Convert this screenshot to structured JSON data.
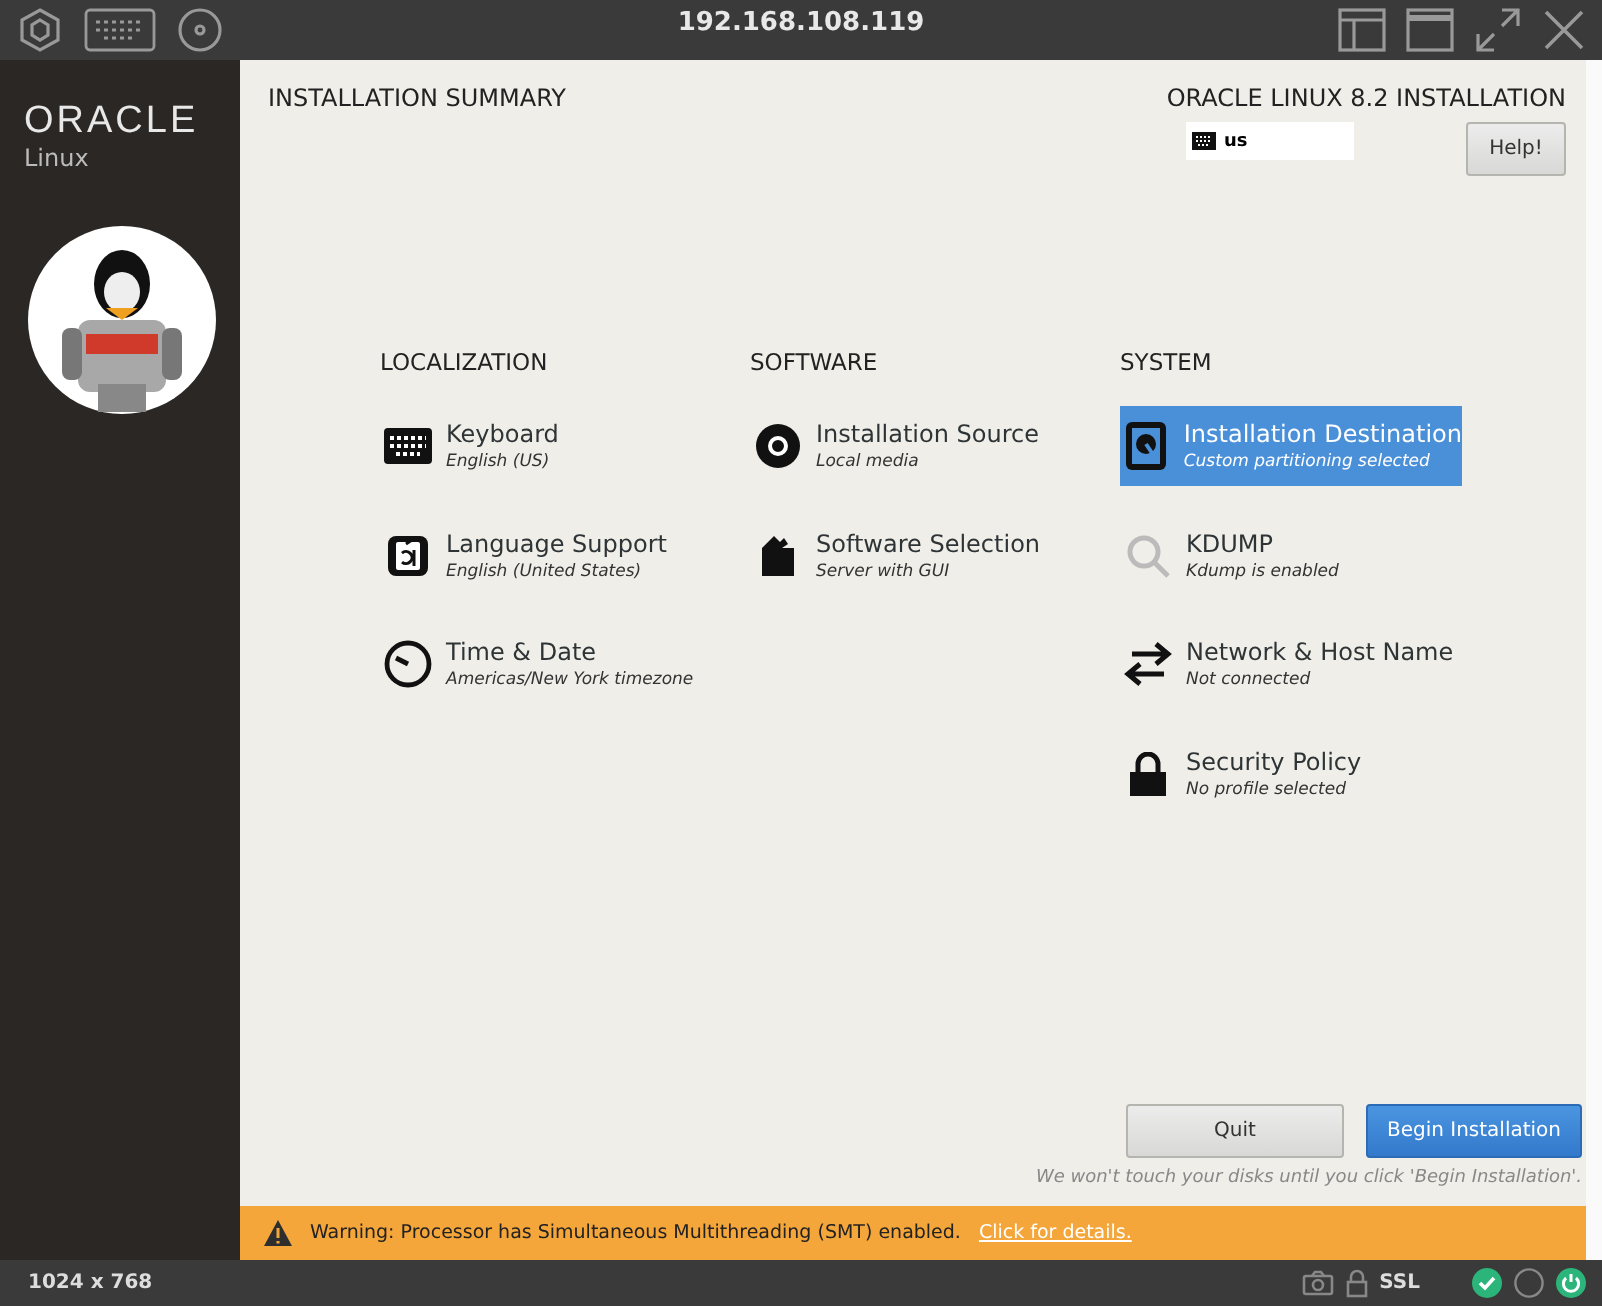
{
  "window": {
    "title": "192.168.108.119"
  },
  "sidebar": {
    "logo_brand": "ORACLE",
    "logo_product": "Linux"
  },
  "header": {
    "title": "INSTALLATION SUMMARY",
    "product": "ORACLE LINUX 8.2 INSTALLATION",
    "keyboard_layout": "us",
    "help_button": "Help!"
  },
  "sections": [
    {
      "heading": "LOCALIZATION",
      "items": [
        {
          "kind": "keyboard",
          "title": "Keyboard",
          "status": "English (US)",
          "selected": false
        },
        {
          "kind": "language",
          "title": "Language Support",
          "status": "English (United States)",
          "selected": false
        },
        {
          "kind": "clock",
          "title": "Time & Date",
          "status": "Americas/New York timezone",
          "selected": false
        }
      ]
    },
    {
      "heading": "SOFTWARE",
      "items": [
        {
          "kind": "disc",
          "title": "Installation Source",
          "status": "Local media",
          "selected": false
        },
        {
          "kind": "package",
          "title": "Software Selection",
          "status": "Server with GUI",
          "selected": false
        }
      ]
    },
    {
      "heading": "SYSTEM",
      "items": [
        {
          "kind": "disk",
          "title": "Installation Destination",
          "status": "Custom partitioning selected",
          "selected": true
        },
        {
          "kind": "search",
          "title": "KDUMP",
          "status": "Kdump is enabled",
          "selected": false
        },
        {
          "kind": "network",
          "title": "Network & Host Name",
          "status": "Not connected",
          "selected": false
        },
        {
          "kind": "lock",
          "title": "Security Policy",
          "status": "No profile selected",
          "selected": false
        }
      ]
    }
  ],
  "buttons": {
    "quit": "Quit",
    "begin": "Begin Installation"
  },
  "note": "We won't touch your disks until you click 'Begin Installation'.",
  "warning": {
    "text": "Warning: Processor has Simultaneous Multithreading (SMT) enabled.",
    "link": "Click for details."
  },
  "status_bar": {
    "resolution": "1024 x 768",
    "ssl": "SSL"
  }
}
